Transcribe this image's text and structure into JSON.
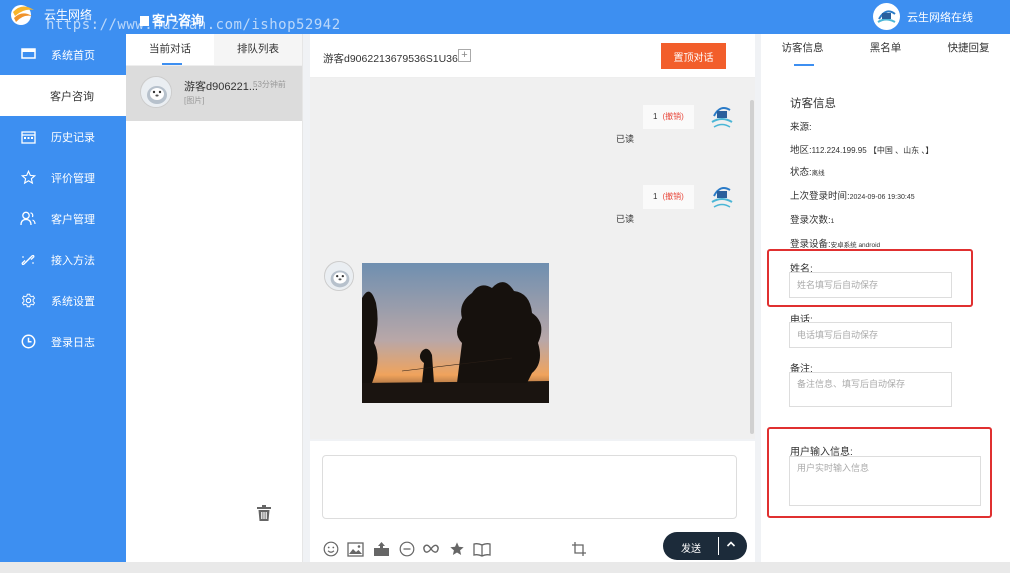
{
  "colors": {
    "primary": "#3d8ff1",
    "accent": "#f25e2b",
    "send": "#1c2b3a",
    "highlight": "#e03030",
    "revoke": "#e84a3d"
  },
  "header": {
    "brand": "云生网络",
    "watermark": "https://www.huzhan.com/ishop52942",
    "page_title": "客户咨询",
    "online_label": "云生网络在线"
  },
  "sidebar": {
    "items": [
      {
        "label": "系统首页",
        "icon": "monitor-icon"
      },
      {
        "label": "客户咨询",
        "icon": "none",
        "active": true
      },
      {
        "label": "历史记录",
        "icon": "calendar-icon"
      },
      {
        "label": "评价管理",
        "icon": "star-icon"
      },
      {
        "label": "客户管理",
        "icon": "users-icon"
      },
      {
        "label": "接入方法",
        "icon": "link-icon"
      },
      {
        "label": "系统设置",
        "icon": "gear-icon"
      },
      {
        "label": "登录日志",
        "icon": "clock-icon"
      }
    ]
  },
  "conversations": {
    "tabs": [
      {
        "label": "当前对话",
        "active": true
      },
      {
        "label": "排队列表",
        "active": false
      }
    ],
    "items": [
      {
        "name": "游客d906221...",
        "time": "53分钟前",
        "preview": "[图片]"
      }
    ]
  },
  "chat": {
    "visitor_id": "游客d9062213679536S1U36",
    "plus_icon": "plus-square-icon",
    "pin_label": "置顶对话",
    "messages": [
      {
        "from": "agent",
        "content": "1",
        "revoke": "(撤销)",
        "status": "已读"
      },
      {
        "from": "agent",
        "content": "1",
        "revoke": "(撤销)",
        "status": "已读"
      },
      {
        "from": "visitor",
        "content": "[image: sunset silhouette of trees]"
      }
    ]
  },
  "composer": {
    "input_value": "",
    "tools": [
      "emoji-icon",
      "image-icon",
      "upload-file-icon",
      "minus-circle-icon",
      "infinity-icon",
      "star-icon",
      "book-icon"
    ],
    "crop_icon": "crop-icon",
    "send_label": "发送"
  },
  "visitor_info": {
    "tabs": [
      {
        "label": "访客信息",
        "active": true
      },
      {
        "label": "黑名单",
        "active": false
      },
      {
        "label": "快捷回复",
        "active": false
      }
    ],
    "heading": "访客信息",
    "source_label": "来源:",
    "region_label": "地区:",
    "region_value": "112.224.199.95 【中国 、山东 、】",
    "status_label": "状态:",
    "status_value": "离线",
    "last_login_label": "上次登录时间:",
    "last_login_value": "2024-09-06 19:30:45",
    "login_count_label": "登录次数:",
    "login_count_value": "1",
    "device_label": "登录设备:",
    "device_value": "安卓系统 android",
    "name_label": "姓名:",
    "name_placeholder": "姓名填写后自动保存",
    "phone_label": "电话:",
    "phone_placeholder": "电话填写后自动保存",
    "note_label": "备注:",
    "note_placeholder": "备注信息、填写后自动保存",
    "user_input_label": "用户输入信息:",
    "user_input_placeholder": "用户实时输入信息"
  }
}
